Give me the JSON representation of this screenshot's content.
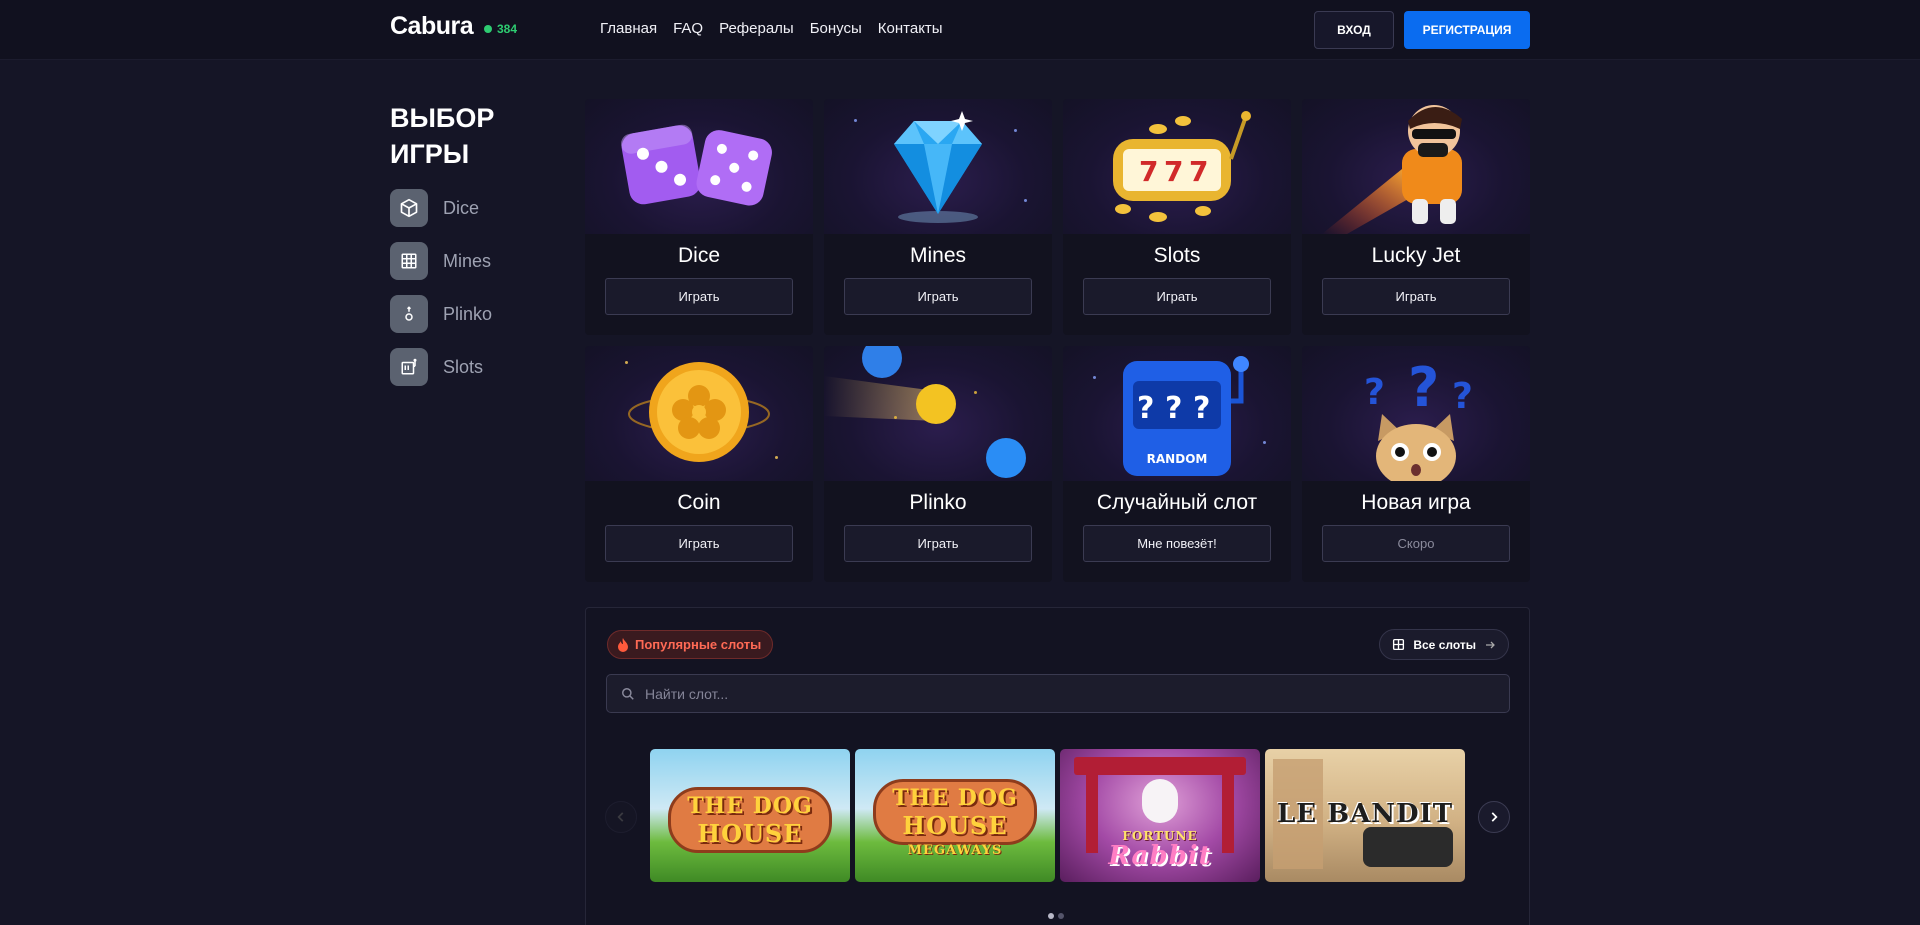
{
  "header": {
    "logo": "Cabura",
    "online_count": "384",
    "nav": [
      "Главная",
      "FAQ",
      "Рефералы",
      "Бонусы",
      "Контакты"
    ],
    "login_label": "ВХОД",
    "register_label": "РЕГИСТРАЦИЯ"
  },
  "sidebar": {
    "title": "ВЫБОР ИГРЫ",
    "items": [
      {
        "label": "Dice",
        "icon": "cube-icon"
      },
      {
        "label": "Mines",
        "icon": "grid-icon"
      },
      {
        "label": "Plinko",
        "icon": "plinko-icon"
      },
      {
        "label": "Slots",
        "icon": "slot-machine-icon"
      }
    ]
  },
  "games": [
    {
      "name": "Dice",
      "button": "Играть"
    },
    {
      "name": "Mines",
      "button": "Играть"
    },
    {
      "name": "Slots",
      "button": "Играть"
    },
    {
      "name": "Lucky Jet",
      "button": "Играть"
    },
    {
      "name": "Coin",
      "button": "Играть"
    },
    {
      "name": "Plinko",
      "button": "Играть"
    },
    {
      "name": "Случайный слот",
      "button": "Мне повезёт!",
      "art_text": "RANDOM"
    },
    {
      "name": "Новая игра",
      "button": "Скоро"
    }
  ],
  "popular": {
    "badge": "Популярные слоты",
    "all_slots": "Все слоты",
    "search_placeholder": "Найти слот...",
    "slots": [
      {
        "line1": "THE DOG",
        "line2": "HOUSE"
      },
      {
        "line1": "THE DOG",
        "line2": "HOUSE",
        "line3": "MEGAWAYS"
      },
      {
        "line1": "FORTUNE",
        "line2": "Rabbit"
      },
      {
        "line1": "LE BANDIT",
        "line2": ""
      }
    ],
    "page_count": 2,
    "active_page": 1
  },
  "colors": {
    "background": "#151526",
    "accent": "#0a6cf0",
    "online": "#2ecc71",
    "hot": "#ff6a55"
  }
}
